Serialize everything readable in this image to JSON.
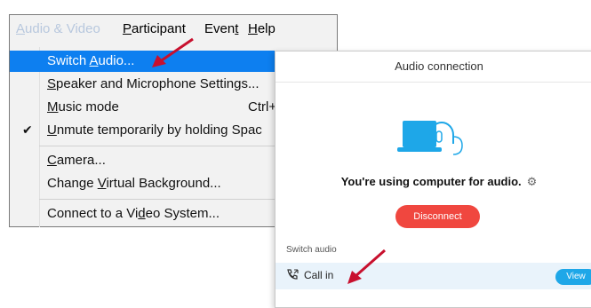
{
  "menubar": {
    "items": [
      {
        "label": "Audio & Video",
        "state": "active"
      },
      {
        "label": "Participant"
      },
      {
        "label": "Event"
      },
      {
        "label": "Help"
      }
    ]
  },
  "menu": {
    "switch_audio": "Switch Audio...",
    "speaker_mic": "Speaker and Microphone Settings...",
    "music_mode": "Music mode",
    "music_mode_shortcut": "Ctrl+S",
    "unmute_temp": "Unmute temporarily by holding Spac",
    "unmute_checked": true,
    "camera": "Camera...",
    "virtual_bg": "Change Virtual Background...",
    "video_system": "Connect to a Video System...",
    "highlight_color": "#0d7ff0"
  },
  "dialog": {
    "title": "Audio connection",
    "close_glyph": "×",
    "status": "You're using computer for audio.",
    "disconnect": "Disconnect",
    "switch_audio_label": "Switch audio",
    "call_in": "Call in",
    "view": "View",
    "disconnect_color": "#f0473f",
    "accent": "#1ea7e8"
  },
  "annotation": {
    "arrow_color": "#c8102e"
  }
}
